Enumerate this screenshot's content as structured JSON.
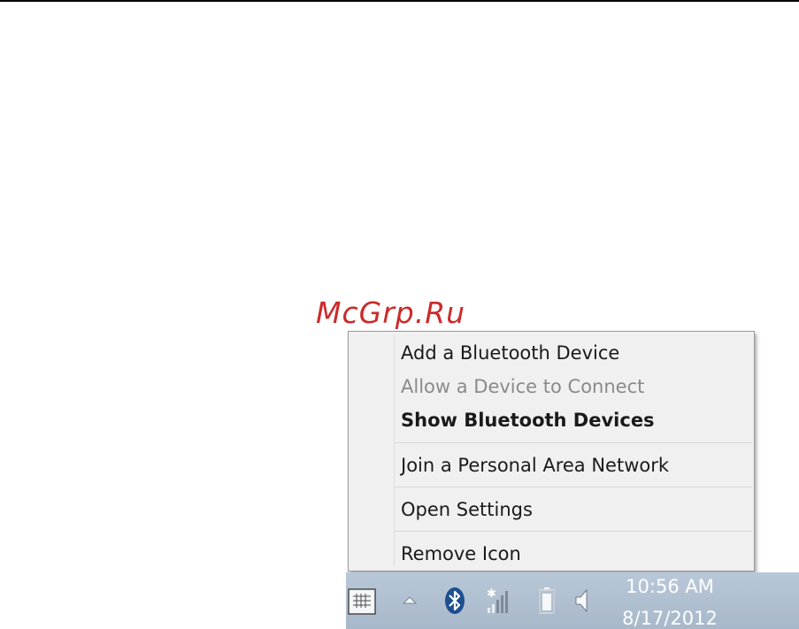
{
  "watermark": "McGrp.Ru",
  "context_menu": {
    "items": [
      {
        "label": "Add a Bluetooth Device",
        "state": "normal"
      },
      {
        "label": "Allow a Device to Connect",
        "state": "disabled"
      },
      {
        "label": "Show Bluetooth Devices",
        "state": "default-bold"
      },
      {
        "label": "Join a Personal Area Network",
        "state": "normal"
      },
      {
        "label": "Open Settings",
        "state": "normal"
      },
      {
        "label": "Remove Icon",
        "state": "normal"
      }
    ]
  },
  "taskbar": {
    "icons": [
      "keyboard-icon",
      "show-hidden-icons-chevron-icon",
      "bluetooth-icon",
      "network-signal-icon",
      "battery-icon",
      "volume-icon"
    ],
    "clock": {
      "time": "10:56 AM",
      "date": "8/17/2012"
    }
  },
  "colors": {
    "watermark": "#cc2a2a",
    "menu_bg": "#f0f0f0",
    "taskbar_bg": "#b0c0d2",
    "bluetooth_blue": "#1d4f8f"
  }
}
